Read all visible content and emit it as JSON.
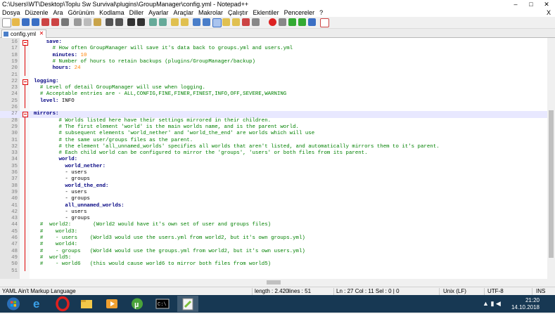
{
  "window": {
    "title": "C:\\Users\\WT\\Desktop\\Toplu Sw Survival\\plugins\\GroupManager\\config.yml - Notepad++",
    "controls": [
      "–",
      "□",
      "✕"
    ]
  },
  "menu": {
    "items": [
      "Dosya",
      "Düzenle",
      "Ara",
      "Görünüm",
      "Kodlama",
      "Diller",
      "Ayarlar",
      "Araçlar",
      "Makrolar",
      "Çalıştır",
      "Eklentiler",
      "Pencereler",
      "?"
    ],
    "close_label": "X"
  },
  "tab": {
    "label": "config.yml",
    "close": "✕"
  },
  "editor": {
    "current_line": 27,
    "lines": [
      {
        "n": "16",
        "parts": [
          {
            "t": "    save:",
            "c": "k"
          }
        ]
      },
      {
        "n": "17",
        "parts": [
          {
            "t": "      # How often GroupManager will save it's data back to groups.yml and users.yml",
            "c": "c"
          }
        ]
      },
      {
        "n": "18",
        "parts": [
          {
            "t": "      minutes: ",
            "c": "k"
          },
          {
            "t": "10",
            "c": "n"
          }
        ]
      },
      {
        "n": "19",
        "parts": [
          {
            "t": "      # Number of hours to retain backups (plugins/GroupManager/backup)",
            "c": "c"
          }
        ]
      },
      {
        "n": "20",
        "parts": [
          {
            "t": "      hours: ",
            "c": "k"
          },
          {
            "t": "24",
            "c": "n"
          }
        ]
      },
      {
        "n": "21",
        "parts": []
      },
      {
        "n": "22",
        "parts": [
          {
            "t": "logging:",
            "c": "k"
          }
        ]
      },
      {
        "n": "23",
        "parts": [
          {
            "t": "  # Level of detail GroupManager will use when logging.",
            "c": "c"
          }
        ]
      },
      {
        "n": "24",
        "parts": [
          {
            "t": "  # Acceptable entries are - ALL,CONFIG,FINE,FINER,FINEST,INFO,OFF,SEVERE,WARNING",
            "c": "c"
          }
        ]
      },
      {
        "n": "25",
        "parts": [
          {
            "t": "  level: ",
            "c": "k"
          },
          {
            "t": "INFO",
            "c": "v"
          }
        ]
      },
      {
        "n": "26",
        "parts": []
      },
      {
        "n": "27",
        "parts": [
          {
            "t": "mirrors:",
            "c": "k"
          }
        ]
      },
      {
        "n": "28",
        "parts": [
          {
            "t": "        # Worlds listed here have their settings mirrored in their children.",
            "c": "c"
          }
        ]
      },
      {
        "n": "29",
        "parts": [
          {
            "t": "        # The first element 'world' is the main worlds name, and is the parent world.",
            "c": "c"
          }
        ]
      },
      {
        "n": "30",
        "parts": [
          {
            "t": "        # subsequent elements 'world_nether' and 'world_the_end' are worlds which will use",
            "c": "c"
          }
        ]
      },
      {
        "n": "31",
        "parts": [
          {
            "t": "        # the same user/groups files as the parent.",
            "c": "c"
          }
        ]
      },
      {
        "n": "32",
        "parts": [
          {
            "t": "        # the element 'all_unnamed_worlds' specifies all worlds that aren't listed, and automatically mirrors them to it's parent.",
            "c": "c"
          }
        ]
      },
      {
        "n": "33",
        "parts": [
          {
            "t": "        # Each child world can be configured to mirror the 'groups', 'users' or both files from its parent.",
            "c": "c"
          }
        ]
      },
      {
        "n": "34",
        "parts": [
          {
            "t": "        world:",
            "c": "k"
          }
        ]
      },
      {
        "n": "35",
        "parts": [
          {
            "t": "          world_nether:",
            "c": "k"
          }
        ]
      },
      {
        "n": "36",
        "parts": [
          {
            "t": "          - users",
            "c": "s"
          }
        ]
      },
      {
        "n": "37",
        "parts": [
          {
            "t": "          - groups",
            "c": "s"
          }
        ]
      },
      {
        "n": "38",
        "parts": [
          {
            "t": "          world_the_end:",
            "c": "k"
          }
        ]
      },
      {
        "n": "39",
        "parts": [
          {
            "t": "          - users",
            "c": "s"
          }
        ]
      },
      {
        "n": "40",
        "parts": [
          {
            "t": "          - groups",
            "c": "s"
          }
        ]
      },
      {
        "n": "41",
        "parts": [
          {
            "t": "          all_unnamed_worlds:",
            "c": "k"
          }
        ]
      },
      {
        "n": "42",
        "parts": [
          {
            "t": "          - users",
            "c": "s"
          }
        ]
      },
      {
        "n": "43",
        "parts": [
          {
            "t": "          - groups",
            "c": "s"
          }
        ]
      },
      {
        "n": "44",
        "parts": [
          {
            "t": "  #  world2:       (World2 would have it's own set of user and groups files)",
            "c": "c"
          }
        ]
      },
      {
        "n": "45",
        "parts": [
          {
            "t": "  #    world3:",
            "c": "c"
          }
        ]
      },
      {
        "n": "46",
        "parts": [
          {
            "t": "  #    - users    (World3 would use the users.yml from world2, but it's own groups.yml)",
            "c": "c"
          }
        ]
      },
      {
        "n": "47",
        "parts": [
          {
            "t": "  #    world4:",
            "c": "c"
          }
        ]
      },
      {
        "n": "48",
        "parts": [
          {
            "t": "  #    - groups   (World4 would use the groups.yml from world2, but it's own users.yml)",
            "c": "c"
          }
        ]
      },
      {
        "n": "49",
        "parts": [
          {
            "t": "  #  world5:",
            "c": "c"
          }
        ]
      },
      {
        "n": "50",
        "parts": [
          {
            "t": "  #    - world6   (this would cause world6 to mirror both files from world5)",
            "c": "c"
          }
        ]
      },
      {
        "n": "51",
        "parts": []
      }
    ]
  },
  "status": {
    "language": "YAML Ain't Markup Language",
    "length": "length : 2.420",
    "lines": "lines : 51",
    "position": "Ln : 27    Col : 11    Sel : 0 | 0",
    "eol": "Unix (LF)",
    "encoding": "UTF-8",
    "mode": "INS"
  },
  "taskbar": {
    "apps": [
      "start-button",
      "ie-icon",
      "opera-icon",
      "file-explorer-icon",
      "media-player-icon",
      "utorrent-icon",
      "cmd-icon",
      "notepadpp-icon"
    ],
    "time": "21:20",
    "date": "14.10.2018"
  }
}
